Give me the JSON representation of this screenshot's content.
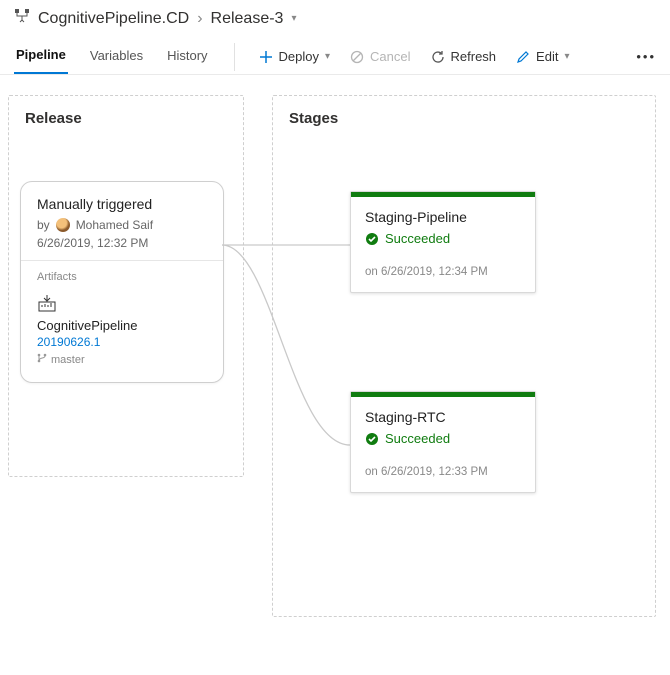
{
  "breadcrumb": {
    "project": "CognitivePipeline.CD",
    "release": "Release-3"
  },
  "tabs": {
    "pipeline": "Pipeline",
    "variables": "Variables",
    "history": "History",
    "active": "pipeline"
  },
  "commands": {
    "deploy": "Deploy",
    "cancel": "Cancel",
    "refresh": "Refresh",
    "edit": "Edit"
  },
  "panels": {
    "release": "Release",
    "stages": "Stages"
  },
  "release": {
    "trigger": "Manually triggered",
    "by_prefix": "by",
    "by_user": "Mohamed Saif",
    "timestamp": "6/26/2019, 12:32 PM",
    "artifacts_label": "Artifacts",
    "artifact_name": "CognitivePipeline",
    "artifact_version": "20190626.1",
    "branch": "master"
  },
  "stages": [
    {
      "name": "Staging-Pipeline",
      "status": "Succeeded",
      "timestamp": "on 6/26/2019, 12:34 PM"
    },
    {
      "name": "Staging-RTC",
      "status": "Succeeded",
      "timestamp": "on 6/26/2019, 12:33 PM"
    }
  ]
}
